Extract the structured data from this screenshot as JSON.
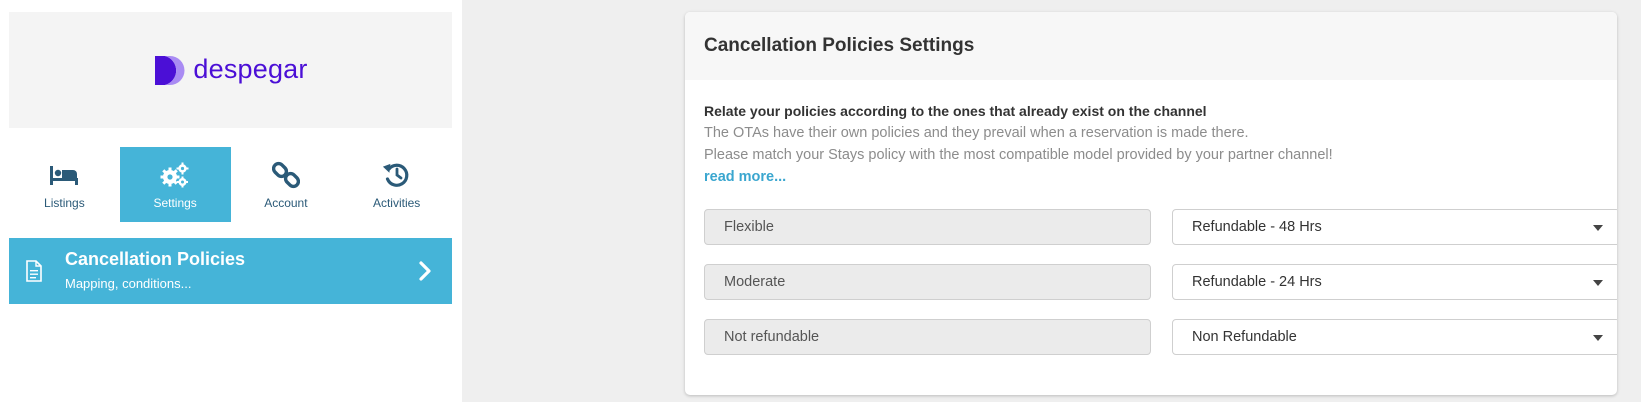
{
  "brand": {
    "name": "despegar",
    "color": "#4b0fd6"
  },
  "accent": "#45b4d8",
  "nav": {
    "items": [
      {
        "label": "Listings",
        "icon": "bed-icon"
      },
      {
        "label": "Settings",
        "icon": "gears-icon",
        "active": true
      },
      {
        "label": "Account",
        "icon": "link-icon"
      },
      {
        "label": "Activities",
        "icon": "history-icon"
      }
    ]
  },
  "menu_card": {
    "title": "Cancellation Policies",
    "subtitle": "Mapping, conditions...",
    "icon": "document-icon",
    "chevron": "chevron-right-icon"
  },
  "panel": {
    "title": "Cancellation Policies Settings",
    "intro_bold": "Relate your policies according to the ones that already exist on the channel",
    "intro_line1": "The OTAs have their own policies and they prevail when a reservation is made there.",
    "intro_line2": "Please match your Stays policy with the most compatible model provided by your partner channel!",
    "read_more": "read more...",
    "rows": [
      {
        "policy": "Flexible",
        "mapped": "Refundable - 48 Hrs"
      },
      {
        "policy": "Moderate",
        "mapped": "Refundable - 24 Hrs"
      },
      {
        "policy": "Not refundable",
        "mapped": "Non Refundable"
      }
    ]
  }
}
